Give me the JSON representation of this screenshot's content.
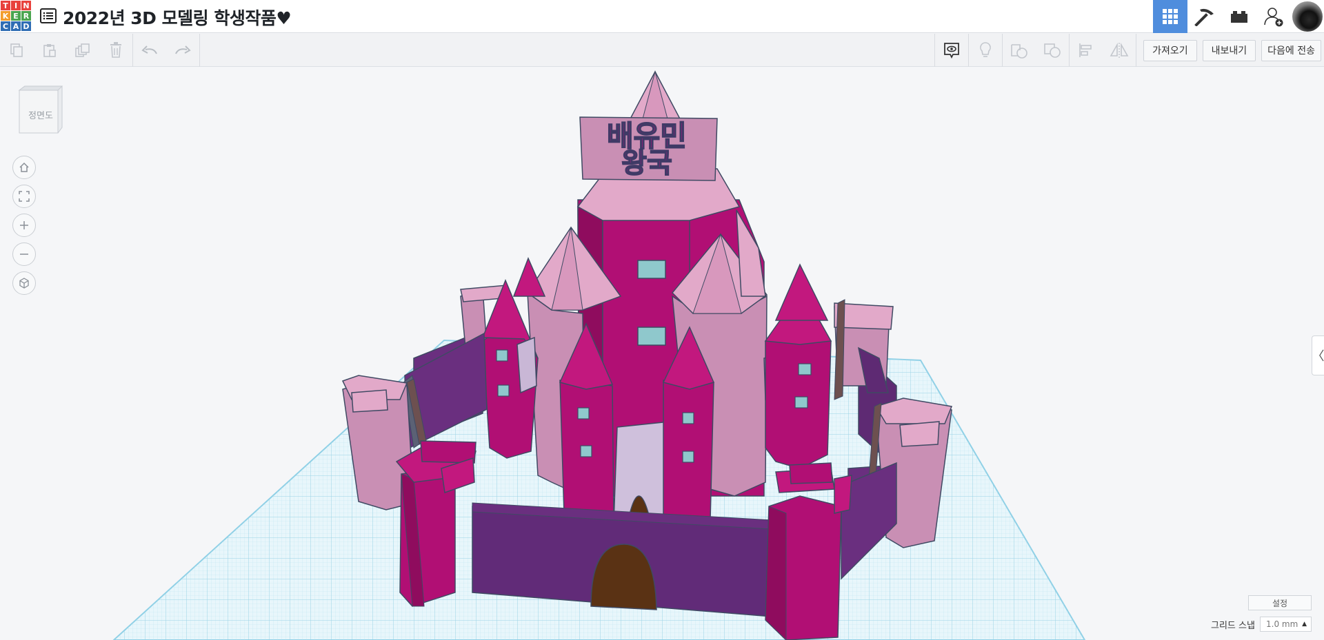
{
  "app": {
    "logo_letters": [
      "T",
      "I",
      "N",
      "K",
      "E",
      "R",
      "C",
      "A",
      "D"
    ],
    "logo_colors": [
      "#e8413c",
      "#e8413c",
      "#e8413c",
      "#f39c2d",
      "#4aa54f",
      "#4aa54f",
      "#2f6db4",
      "#2f6db4",
      "#2f6db4"
    ],
    "title": "2022년 3D 모델링 학생작품♥"
  },
  "top_right": {
    "items": [
      {
        "name": "3d-design-view-icon",
        "active": true
      },
      {
        "name": "blocks-pickaxe-icon",
        "active": false
      },
      {
        "name": "bricks-icon",
        "active": false
      },
      {
        "name": "invite-user-icon",
        "active": false
      }
    ]
  },
  "toolbar": {
    "left_icons": [
      "copy-icon",
      "paste-icon",
      "duplicate-icon",
      "delete-icon",
      "undo-icon",
      "redo-icon"
    ],
    "right_icons": [
      "notes-visibility-icon",
      "light-bulb-icon",
      "shape-icon",
      "group-icon",
      "align-icon",
      "mirror-icon"
    ],
    "import_label": "가져오기",
    "export_label": "내보내기",
    "send_to_label": "다음에 전송"
  },
  "workspace": {
    "viewcube_label": "정면도",
    "nav_icons": [
      "home-icon",
      "fit-view-icon",
      "zoom-in-icon",
      "zoom-out-icon",
      "perspective-icon"
    ],
    "side_panel_toggle": "〈",
    "settings_label": "설정",
    "grid_snap_label": "그리드 스냅",
    "grid_snap_value": "1.0 mm",
    "sign_text_line1": "배유민",
    "sign_text_line2": "왕국"
  },
  "colors": {
    "accent": "#4f8ddd",
    "magenta": "#b10f74",
    "pink": "#c98fb4",
    "light_pink": "#e2a9c9",
    "purple": "#6a2f7f",
    "door": "#5a3214",
    "grid_line": "#9fd6ea",
    "window": "#8fc8cc"
  }
}
